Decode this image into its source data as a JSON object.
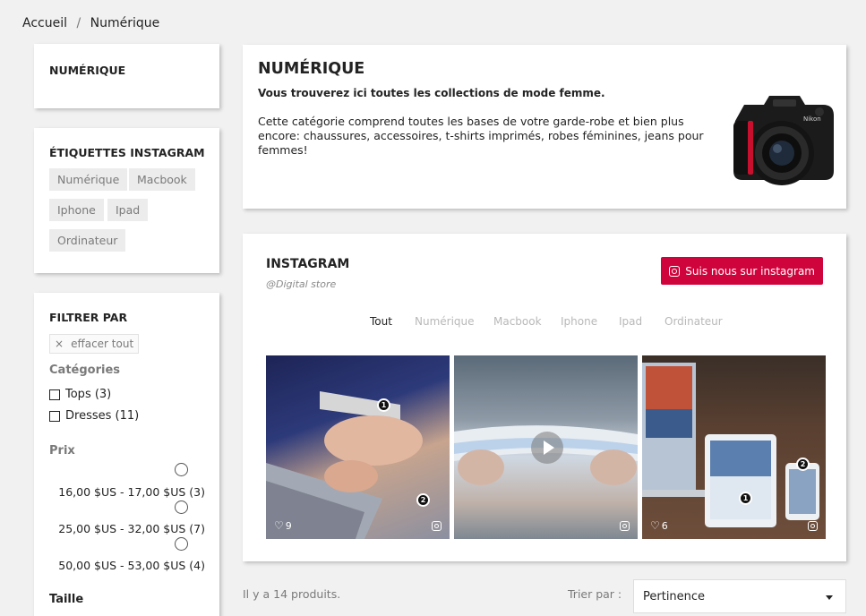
{
  "breadcrumb": {
    "home": "Accueil",
    "separator": "/",
    "current": "Numérique"
  },
  "sidebar": {
    "category_block": {
      "title": "NUMÉRIQUE"
    },
    "tags_block": {
      "title": "ÉTIQUETTES INSTAGRAM",
      "tags": [
        "Numérique",
        "Macbook",
        "Iphone",
        "Ipad",
        "Ordinateur"
      ]
    },
    "filters": {
      "title": "FILTRER PAR",
      "clear_icon": "×",
      "clear_label": "effacer tout",
      "categories_heading": "Catégories",
      "categories": [
        {
          "label": "Tops (3)",
          "checked": false
        },
        {
          "label": "Dresses (11)",
          "checked": false
        }
      ],
      "price_heading": "Prix",
      "prices": [
        "16,00 $US - 17,00 $US (3)",
        "25,00 $US - 32,00 $US (7)",
        "50,00 $US - 53,00 $US (4)"
      ],
      "size_heading": "Taille"
    }
  },
  "category_header": {
    "title": "NUMÉRIQUE",
    "subtitle": "Vous trouverez ici toutes les collections de mode femme.",
    "description": "Cette catégorie comprend toutes les bases de votre garde-robe et bien plus encore: chaussures, accessoires, t-shirts imprimés, robes féminines, jeans pour femmes!",
    "image_icon": "camera-dslr"
  },
  "instagram": {
    "title": "INSTAGRAM",
    "handle": "@Digital store",
    "follow_label": "Suis nous sur instagram",
    "follow_icon": "instagram-icon",
    "tabs": [
      {
        "label": "Tout",
        "active": true
      },
      {
        "label": "Numérique",
        "active": false
      },
      {
        "label": "Macbook",
        "active": false
      },
      {
        "label": "Iphone",
        "active": false
      },
      {
        "label": "Ipad",
        "active": false
      },
      {
        "label": "Ordinateur",
        "active": false
      }
    ],
    "posts": [
      {
        "likes": "9",
        "hotspots": [
          "1",
          "2"
        ],
        "video": false
      },
      {
        "likes": "",
        "hotspots": [],
        "video": true
      },
      {
        "likes": "6",
        "hotspots": [
          "2",
          "1"
        ],
        "video": false
      }
    ],
    "heart_icon": "♡"
  },
  "listing": {
    "count_text": "Il y a 14 produits.",
    "sort_label": "Trier par :",
    "sort_value": "Pertinence"
  },
  "colors": {
    "accent": "#d0043c",
    "background": "#f1f1f1",
    "tag_bg": "#ececec",
    "muted_text": "#7a7a7a"
  }
}
